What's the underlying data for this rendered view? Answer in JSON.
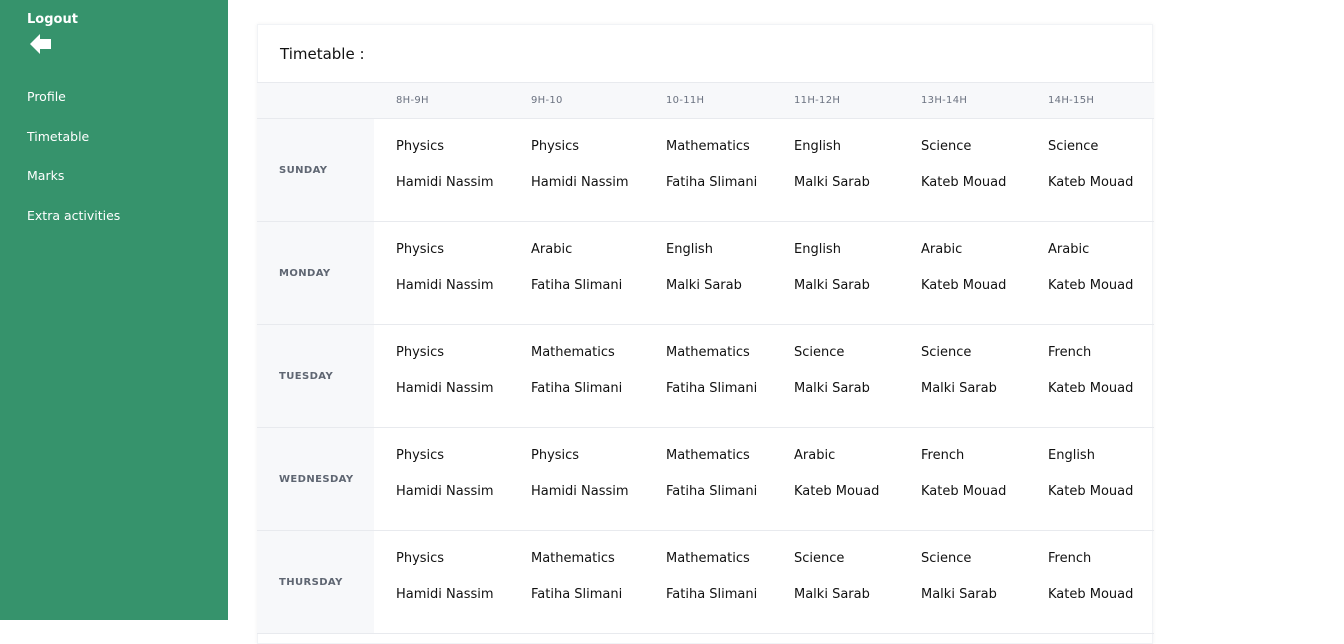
{
  "sidebar": {
    "logout_label": "Logout",
    "logout_icon": "arrow-left-icon",
    "items": [
      {
        "label": "Profile"
      },
      {
        "label": "Timetable"
      },
      {
        "label": "Marks"
      },
      {
        "label": "Extra activities"
      }
    ],
    "background": "#36936c"
  },
  "timetable": {
    "title": "Timetable :",
    "columns": [
      "8H-9H",
      "9H-10",
      "10-11H",
      "11H-12H",
      "13H-14H",
      "14H-15H"
    ],
    "rows": [
      {
        "day": "SUNDAY",
        "cells": [
          {
            "subject": "Physics",
            "teacher": "Hamidi Nassim"
          },
          {
            "subject": "Physics",
            "teacher": "Hamidi Nassim"
          },
          {
            "subject": "Mathematics",
            "teacher": "Fatiha Slimani"
          },
          {
            "subject": "English",
            "teacher": "Malki Sarab"
          },
          {
            "subject": "Science",
            "teacher": "Kateb Mouad"
          },
          {
            "subject": "Science",
            "teacher": "Kateb Mouad"
          }
        ]
      },
      {
        "day": "MONDAY",
        "cells": [
          {
            "subject": "Physics",
            "teacher": "Hamidi Nassim"
          },
          {
            "subject": "Arabic",
            "teacher": "Fatiha Slimani"
          },
          {
            "subject": "English",
            "teacher": "Malki Sarab"
          },
          {
            "subject": "English",
            "teacher": "Malki Sarab"
          },
          {
            "subject": "Arabic",
            "teacher": "Kateb Mouad"
          },
          {
            "subject": "Arabic",
            "teacher": "Kateb Mouad"
          }
        ]
      },
      {
        "day": "TUESDAY",
        "cells": [
          {
            "subject": "Physics",
            "teacher": "Hamidi Nassim"
          },
          {
            "subject": "Mathematics",
            "teacher": "Fatiha Slimani"
          },
          {
            "subject": "Mathematics",
            "teacher": "Fatiha Slimani"
          },
          {
            "subject": "Science",
            "teacher": "Malki Sarab"
          },
          {
            "subject": "Science",
            "teacher": "Malki Sarab"
          },
          {
            "subject": "French",
            "teacher": "Kateb Mouad"
          }
        ]
      },
      {
        "day": "WEDNESDAY",
        "cells": [
          {
            "subject": "Physics",
            "teacher": "Hamidi Nassim"
          },
          {
            "subject": "Physics",
            "teacher": "Hamidi Nassim"
          },
          {
            "subject": "Mathematics",
            "teacher": "Fatiha Slimani"
          },
          {
            "subject": "Arabic",
            "teacher": "Kateb Mouad"
          },
          {
            "subject": "French",
            "teacher": "Kateb Mouad"
          },
          {
            "subject": "English",
            "teacher": "Kateb Mouad"
          }
        ]
      },
      {
        "day": "THURSDAY",
        "cells": [
          {
            "subject": "Physics",
            "teacher": "Hamidi Nassim"
          },
          {
            "subject": "Mathematics",
            "teacher": "Fatiha Slimani"
          },
          {
            "subject": "Mathematics",
            "teacher": "Fatiha Slimani"
          },
          {
            "subject": "Science",
            "teacher": "Malki Sarab"
          },
          {
            "subject": "Science",
            "teacher": "Malki Sarab"
          },
          {
            "subject": "French",
            "teacher": "Kateb Mouad"
          }
        ]
      }
    ]
  }
}
